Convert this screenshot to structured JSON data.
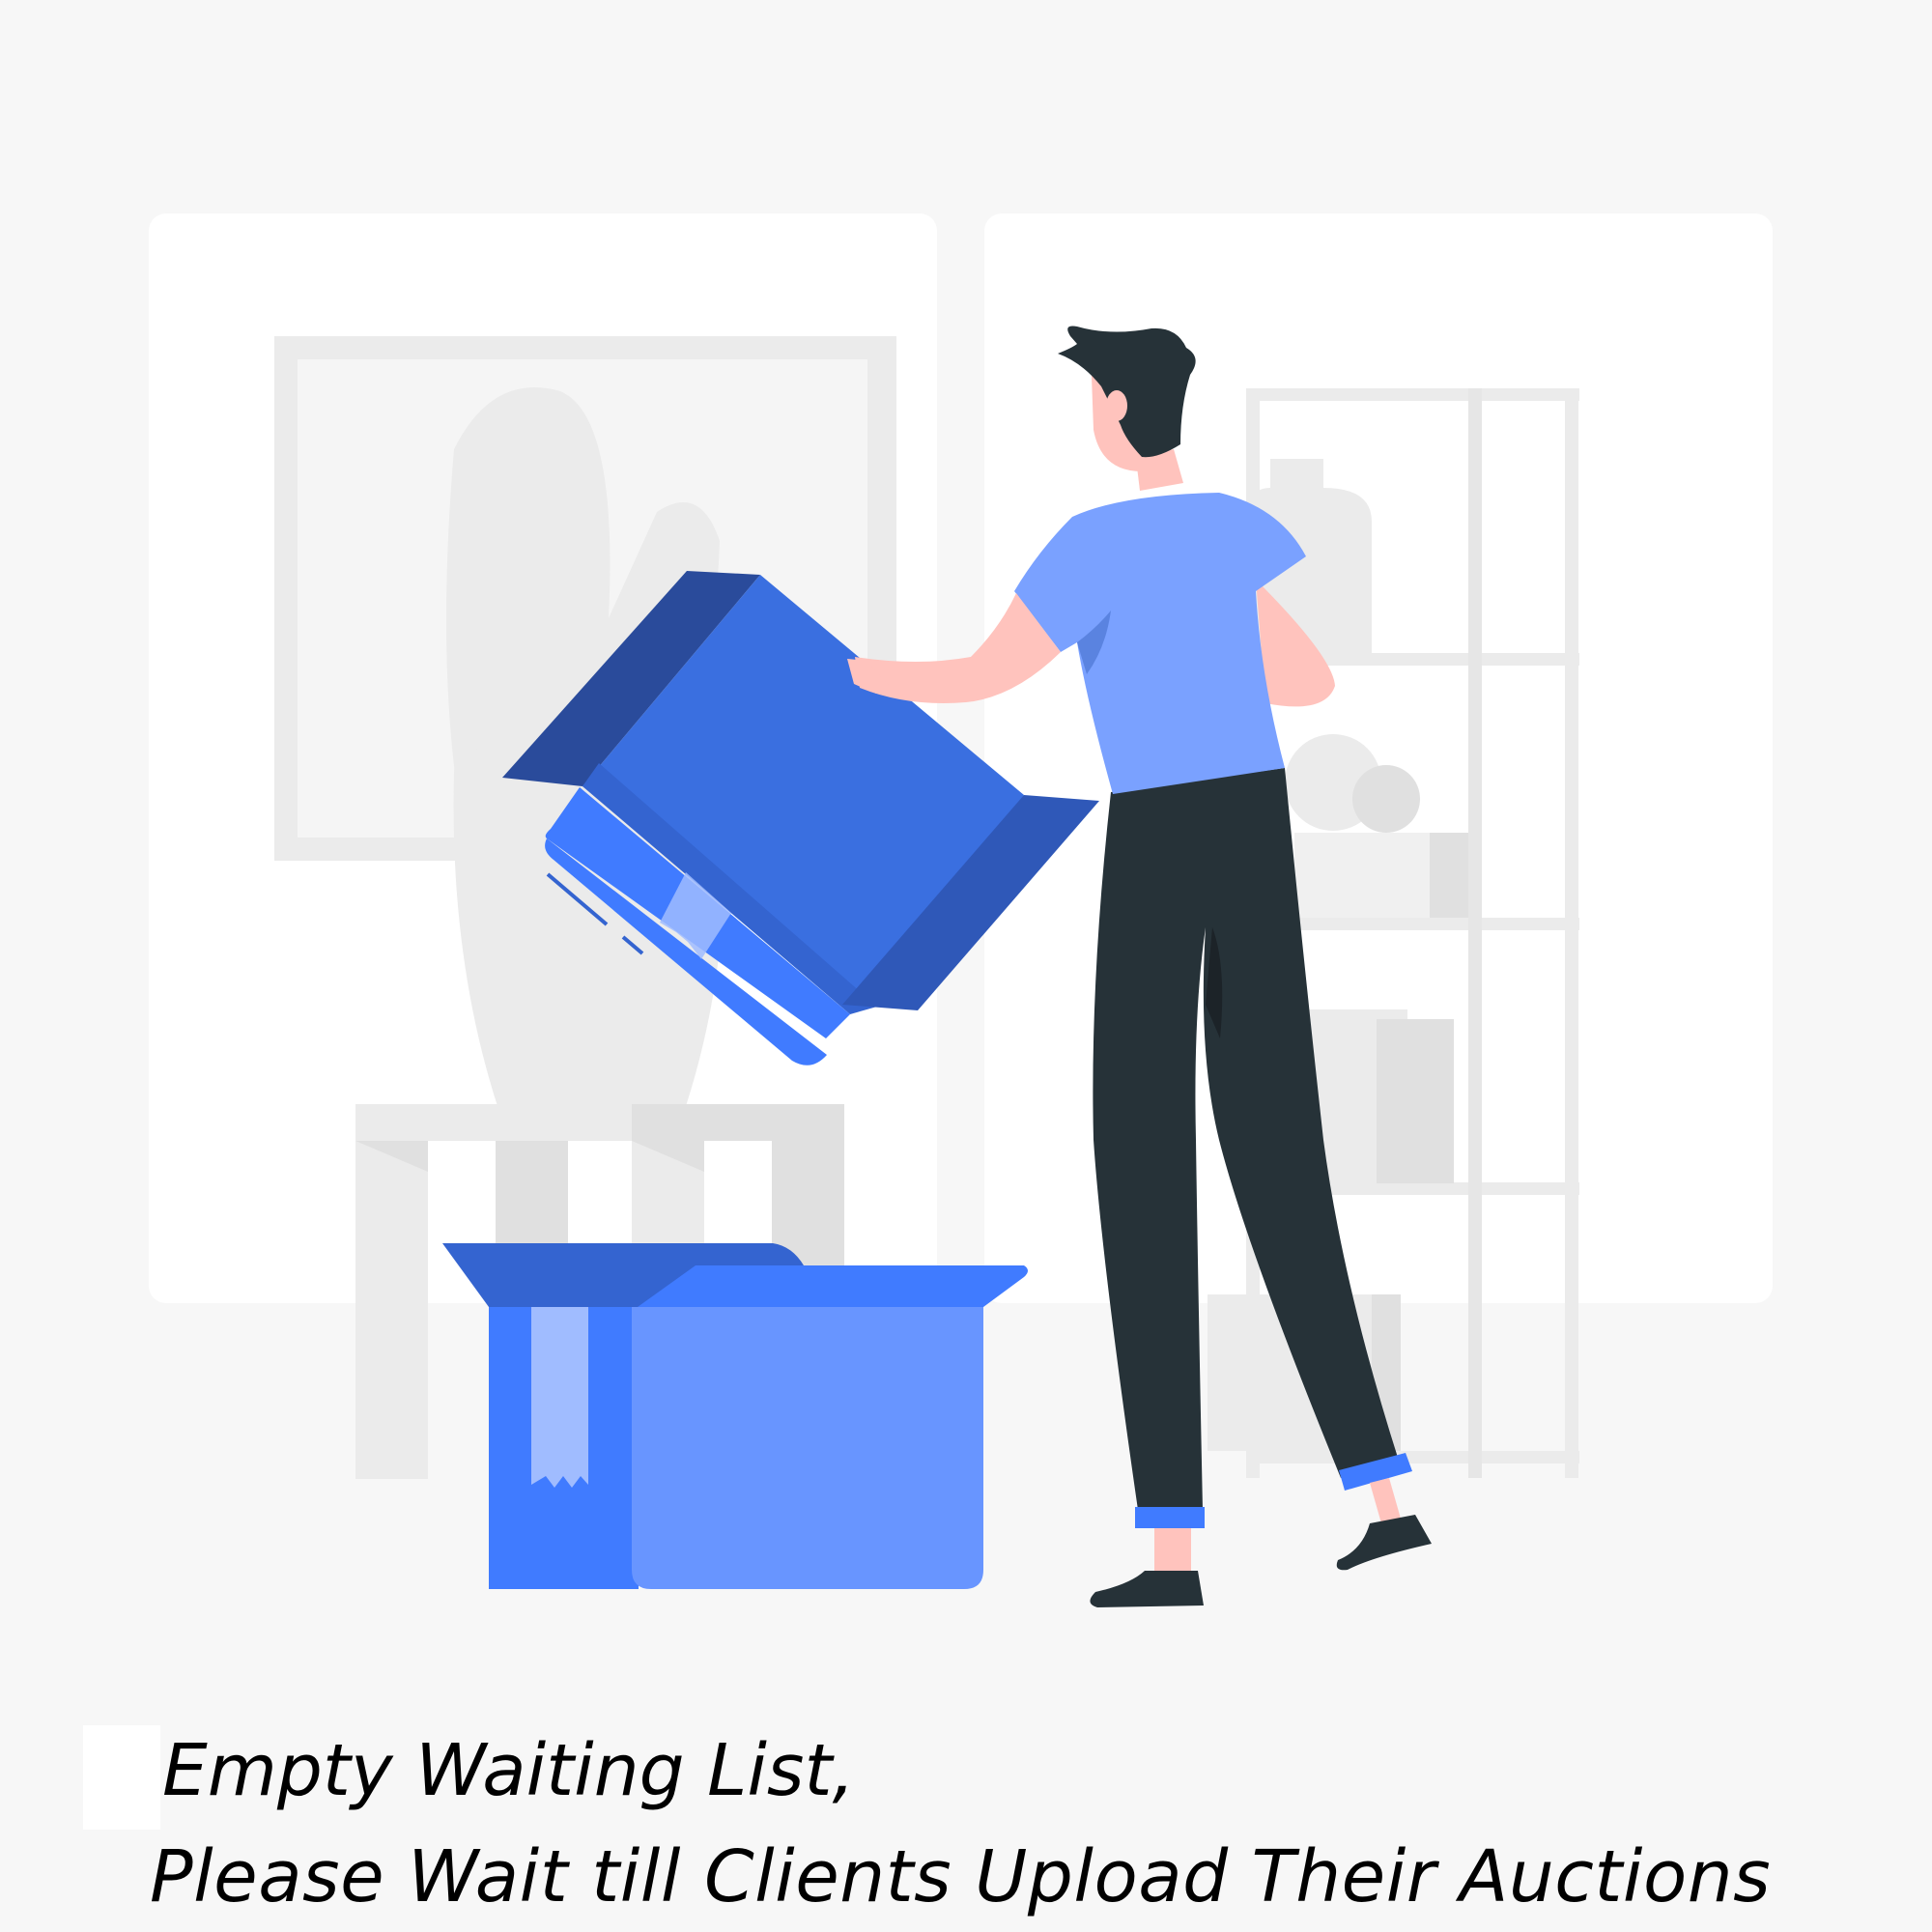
{
  "empty_state": {
    "illustration": "person-unpacking-boxes",
    "message_line_1": "Empty Waiting List,",
    "message_line_2": "Please Wait till Clients Upload Their Auctions"
  },
  "colors": {
    "background": "#f7f7f7",
    "panel": "#ffffff",
    "box_blue": "#407bff",
    "box_light_blue": "#6895ff",
    "box_dark_blue": "#2a4b9b",
    "shirt": "#7aa1ff",
    "pants": "#263238",
    "skin": "#ffc3bd",
    "text": "#000000"
  }
}
